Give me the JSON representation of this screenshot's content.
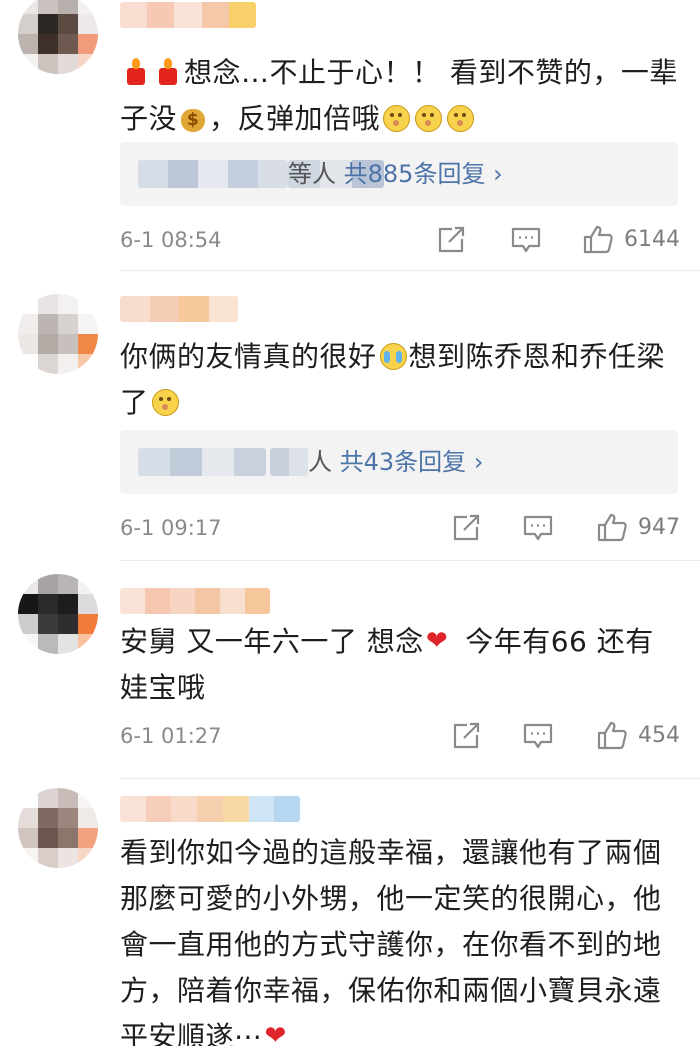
{
  "comments": [
    {
      "text_parts": [
        "想念…不止于心！！ 看到不赞的，一辈子没",
        "，反弹加倍哦"
      ],
      "reply": {
        "names": "等人",
        "count": "共885条回复",
        "arrow": "›"
      },
      "time": "6-1 08:54",
      "likes": "6144",
      "icons": [
        "candle-emoji",
        "candle-emoji",
        "money-bag-emoji",
        "rolling-eyes-emoji"
      ]
    },
    {
      "text_parts": [
        "你俩的友情真的很好",
        "想到陈乔恩和乔任梁了"
      ],
      "reply": {
        "names": "人",
        "count": "共43条回复",
        "arrow": "›"
      },
      "time": "6-1 09:17",
      "likes": "947",
      "icons": [
        "crying-emoji",
        "rolling-eyes-emoji"
      ]
    },
    {
      "text_parts": [
        "安舅 又一年六一了 想念",
        " 今年有66 还有娃宝哦"
      ],
      "time": "6-1 01:27",
      "likes": "454",
      "icons": [
        "heart-emoji"
      ]
    },
    {
      "text": "看到你如今過的這般幸福，還讓他有了兩個那麼可愛的小外甥，他一定笑的很開心，他會一直用他的方式守護你，在你看不到的地方，陪着你幸福，保佑你和兩個小寶貝永遠平安順遂⋯",
      "icons": [
        "heart-emoji"
      ]
    }
  ],
  "colors": {
    "reply_count": "#4d74a8",
    "meta_text": "#8a8a8a",
    "heart": "#e0242b",
    "reply_bg": "#f3f3f3"
  },
  "action_icons": [
    "share-icon",
    "comment-icon",
    "thumbs-up-icon"
  ]
}
